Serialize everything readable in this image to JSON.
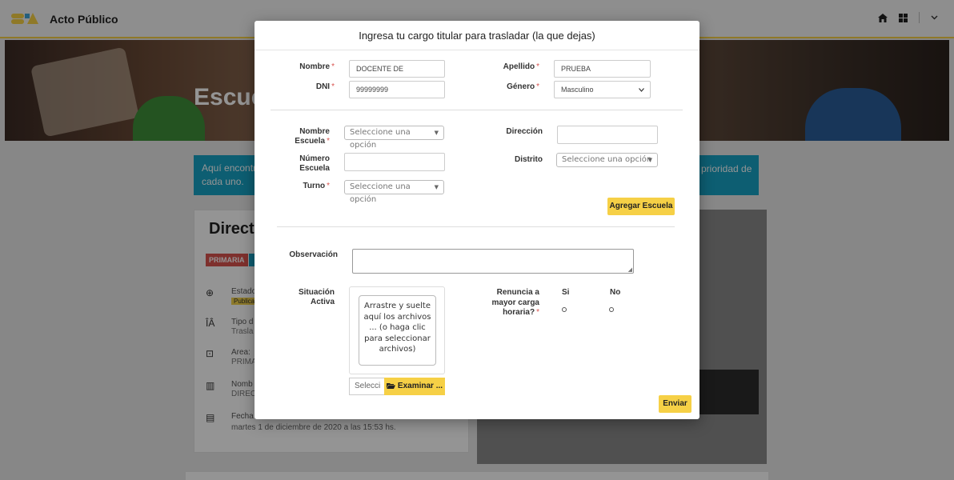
{
  "app": {
    "title": "Acto Público",
    "brand_color": "#f6d046"
  },
  "header_icons": [
    "home-icon",
    "grid-icon",
    "chevron-down-icon"
  ],
  "hero": {
    "title": "Escue"
  },
  "banner": {
    "text": "Aquí encontra\ncada uno.",
    "right_text": "prioridad de"
  },
  "card": {
    "title": "Direct",
    "badge": "PRIMARIA",
    "rows": [
      {
        "icon": "plus-circle-icon",
        "label": "Estado",
        "sub": "Publica"
      },
      {
        "icon": "people-icon",
        "label": "Tipo d",
        "sub": "Trasla"
      },
      {
        "icon": "area-icon",
        "label": "Area:",
        "sub": "PRIMA"
      },
      {
        "icon": "briefcase-icon",
        "label": "Nomb",
        "sub": "DIRECT"
      },
      {
        "icon": "calendar-icon",
        "label": "Fecha",
        "sub": ""
      }
    ],
    "date": "martes 1 de diciembre de 2020 a las 15:53 hs."
  },
  "modal": {
    "title": "Ingresa tu cargo titular para trasladar (la que dejas)",
    "nombre": {
      "label": "Nombre",
      "value": "DOCENTE DE"
    },
    "apellido": {
      "label": "Apellido",
      "value": "PRUEBA"
    },
    "dni": {
      "label": "DNI",
      "value": "99999999"
    },
    "genero": {
      "label": "Género",
      "value": "Masculino"
    },
    "nombre_escuela": {
      "label_1": "Nombre",
      "label_2": "Escuela",
      "placeholder": "Seleccione una opción"
    },
    "direccion": {
      "label": "Dirección",
      "value": ""
    },
    "numero_escuela": {
      "label_1": "Número",
      "label_2": "Escuela",
      "value": ""
    },
    "distrito": {
      "label": "Distrito",
      "placeholder": "Seleccione una opción"
    },
    "turno": {
      "label": "Turno",
      "placeholder": "Seleccione una opción"
    },
    "agregar_escuela": "Agregar Escuela",
    "observacion": {
      "label": "Observación",
      "value": ""
    },
    "situacion": {
      "label_1": "Situación",
      "label_2": "Activa"
    },
    "dropzone": "Arrastre y suelte aquí los archivos ... (o haga clic para seleccionar archivos)",
    "file_placeholder": "Selecci",
    "browse": "Examinar ...",
    "renuncia": {
      "label_1": "Renuncia a",
      "label_2": "mayor carga",
      "label_3": "horaria?",
      "opt_si": "Si",
      "opt_no": "No"
    },
    "enviar": "Enviar",
    "required_mark": "*"
  }
}
